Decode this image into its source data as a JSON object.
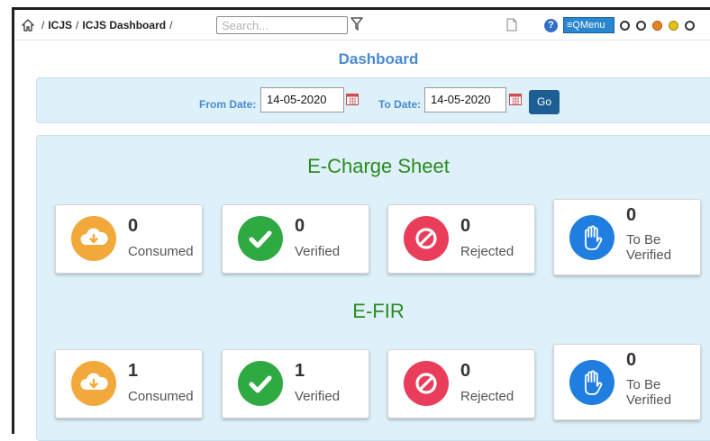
{
  "breadcrumb": {
    "items": [
      "ICJS",
      "ICJS Dashboard"
    ],
    "separator": "/"
  },
  "search": {
    "placeholder": "Search..."
  },
  "toolbar": {
    "qmenu_label": "≡QMenu",
    "help_glyph": "?"
  },
  "page": {
    "title": "Dashboard"
  },
  "date_filter": {
    "from_label": "From Date:",
    "from_value": "14-05-2020",
    "to_label": "To Date:",
    "to_value": "14-05-2020",
    "go_label": "Go"
  },
  "sections": [
    {
      "title": "E-Charge Sheet",
      "cards": [
        {
          "value": "0",
          "label": "Consumed",
          "icon": "cloud-download-icon",
          "color": "#f2a83a"
        },
        {
          "value": "0",
          "label": "Verified",
          "icon": "check-icon",
          "color": "#2faa43"
        },
        {
          "value": "0",
          "label": "Rejected",
          "icon": "ban-icon",
          "color": "#ea3d5b"
        },
        {
          "value": "0",
          "label_line1": "To Be",
          "label_line2": "Verified",
          "icon": "hand-icon",
          "color": "#1f7ee0"
        }
      ]
    },
    {
      "title": "E-FIR",
      "cards": [
        {
          "value": "1",
          "label": "Consumed",
          "icon": "cloud-download-icon",
          "color": "#f2a83a"
        },
        {
          "value": "1",
          "label": "Verified",
          "icon": "check-icon",
          "color": "#2faa43"
        },
        {
          "value": "0",
          "label": "Rejected",
          "icon": "ban-icon",
          "color": "#ea3d5b"
        },
        {
          "value": "0",
          "label_line1": "To Be",
          "label_line2": "Verified",
          "icon": "hand-icon",
          "color": "#1f7ee0"
        }
      ]
    }
  ],
  "theme_dots": [
    "#ffffff",
    "#ffffff",
    "#e8822a",
    "#e2c21a",
    "#ffffff"
  ]
}
